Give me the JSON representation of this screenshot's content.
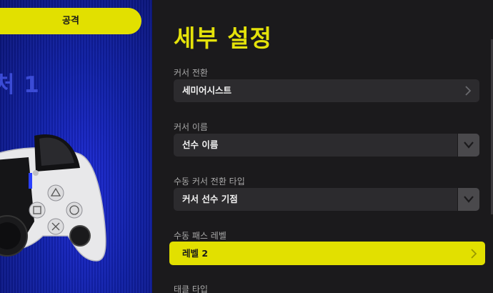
{
  "left_panel": {
    "attack_button": "공격",
    "preset_title": "처 1"
  },
  "settings": {
    "heading": "세부 설정",
    "items": [
      {
        "label": "커서 전환",
        "value": "세미어시스트",
        "control": "chevron"
      },
      {
        "label": "커서 이름",
        "value": "선수 이름",
        "control": "dropdown"
      },
      {
        "label": "수동 커서 전환 타입",
        "value": "커서 선수 기점",
        "control": "dropdown"
      },
      {
        "label": "수동 패스 레벨",
        "value": "레벨 2",
        "control": "chevron",
        "selected": true
      },
      {
        "label": "태클 타입"
      }
    ]
  },
  "colors": {
    "accent": "#e2e000",
    "panel_bg": "#1b1a1c",
    "control_bg": "#2c2b2e",
    "preview_bg": "#1020a8"
  },
  "icons": [
    "chevron-right-icon",
    "chevron-down-icon",
    "controller-image",
    "triangle-icon",
    "square-icon",
    "circle-icon",
    "cross-icon"
  ]
}
